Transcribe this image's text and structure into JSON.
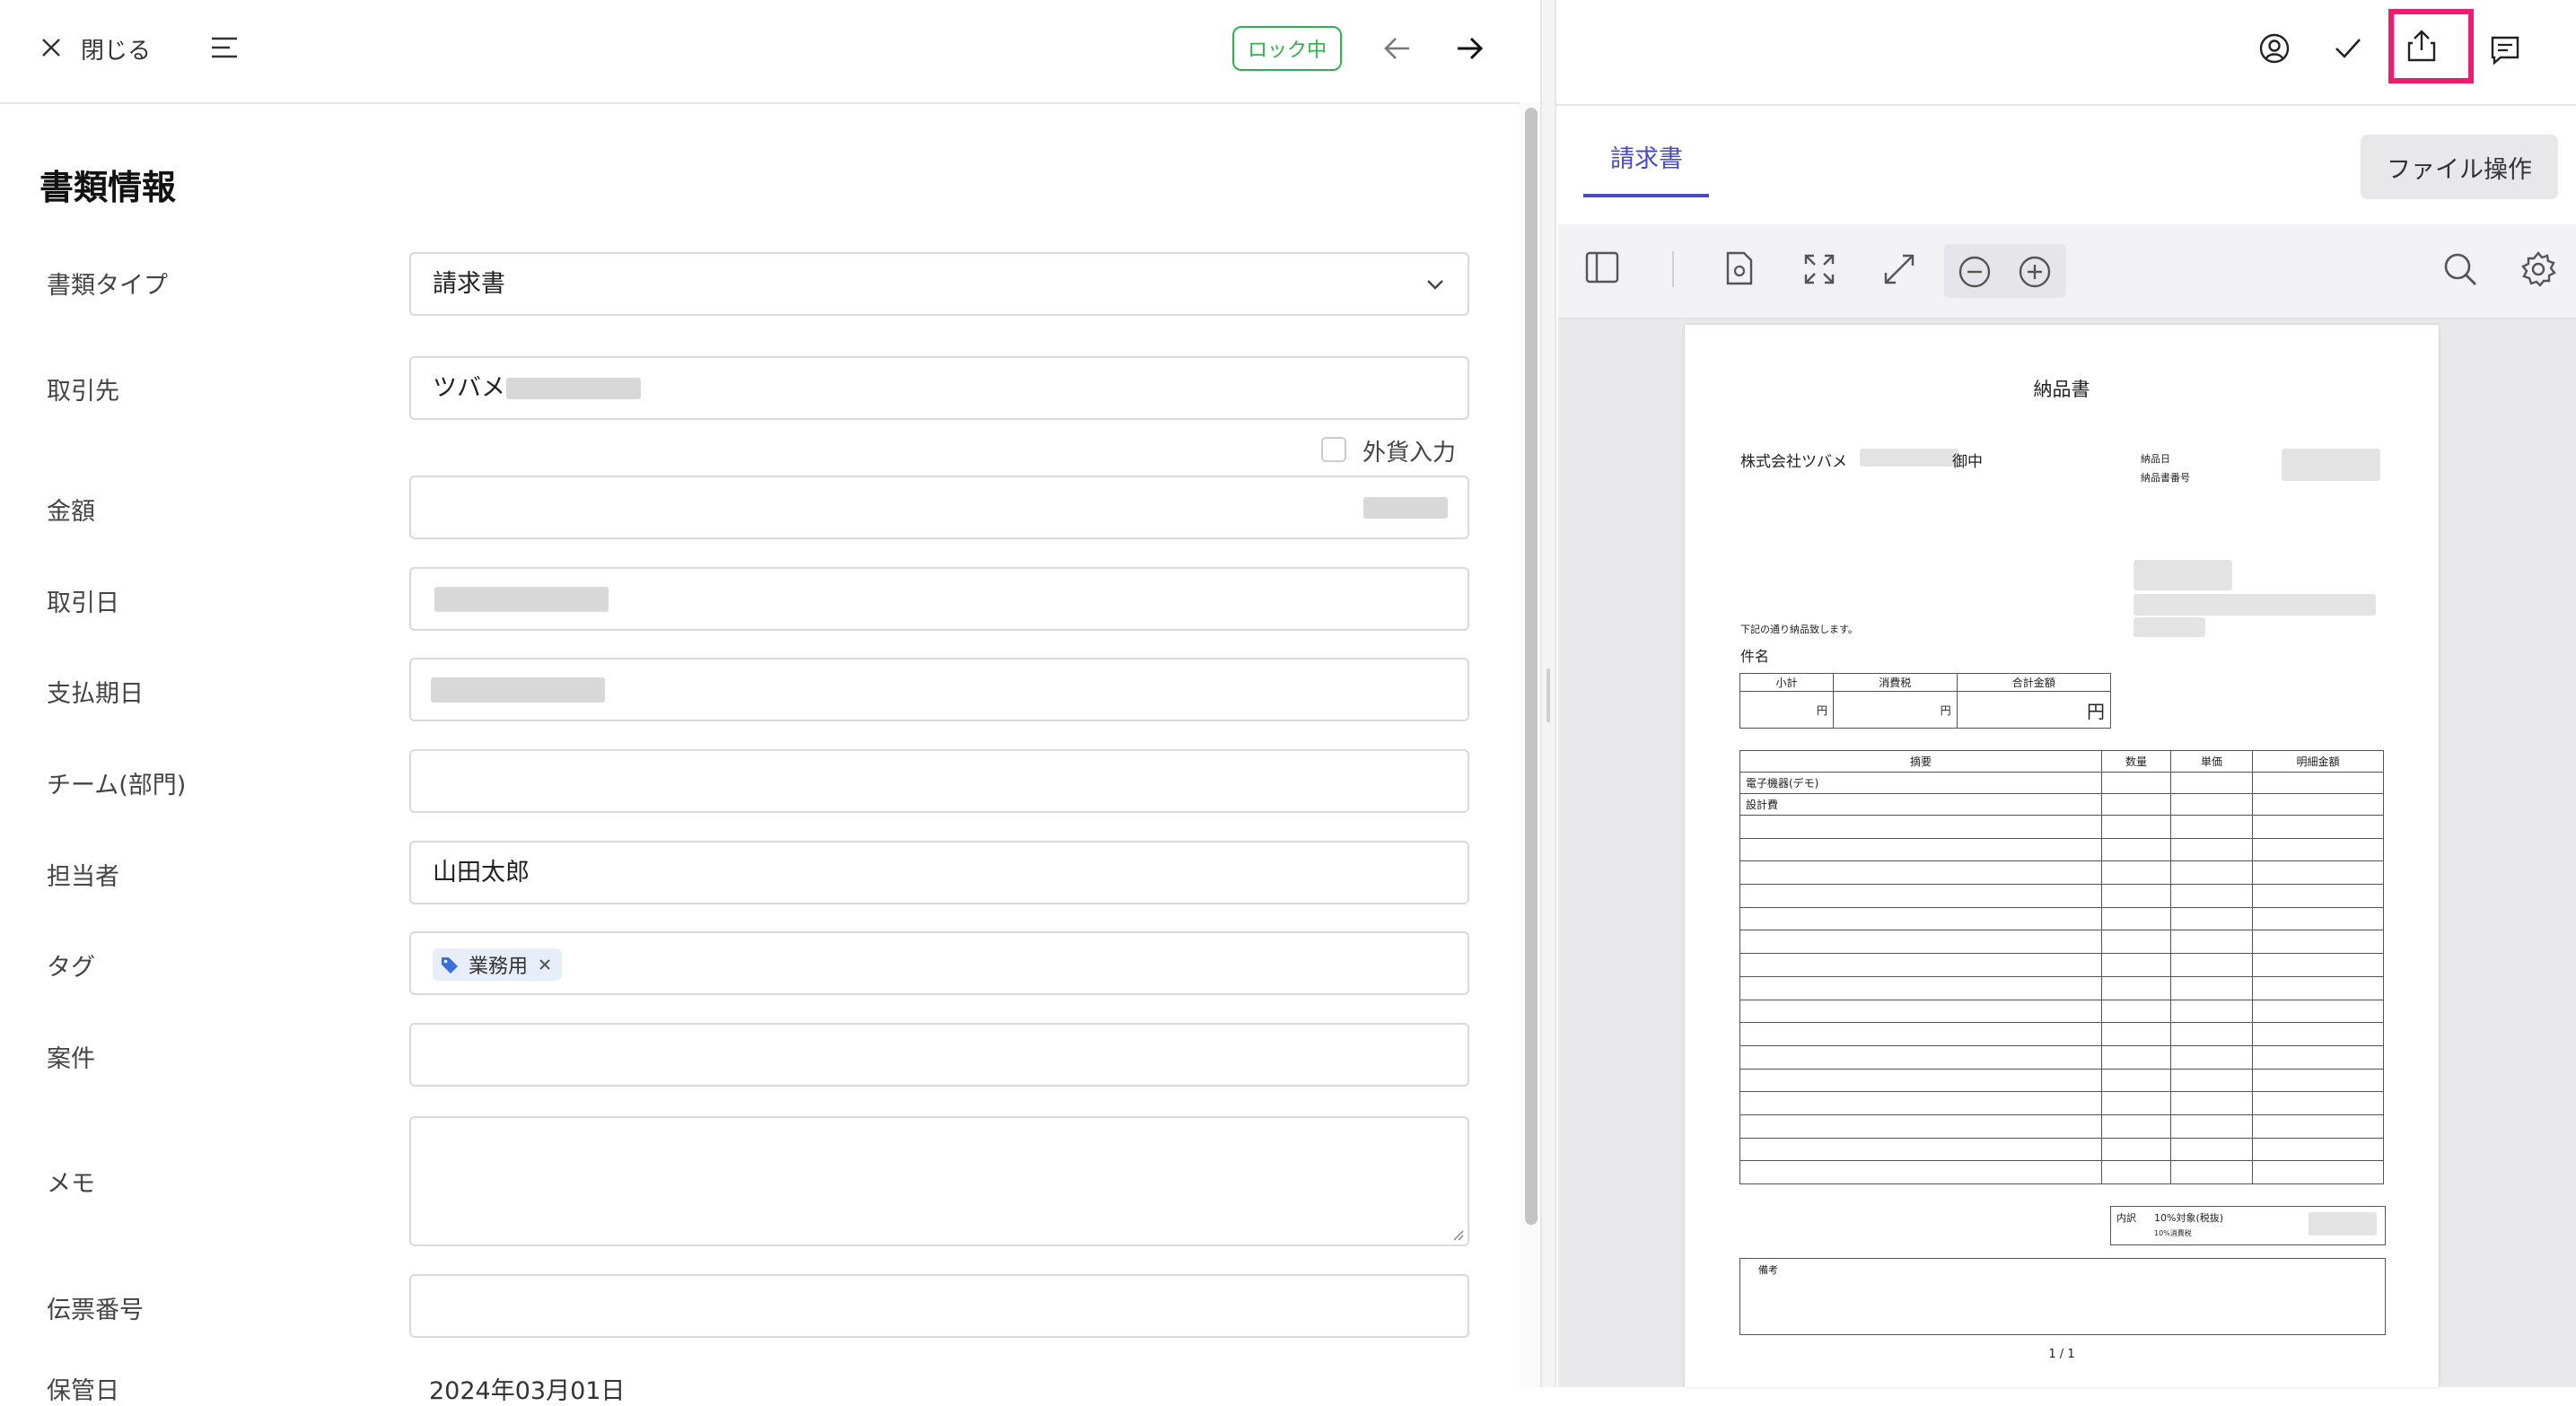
{
  "header": {
    "close_label": "閉じる",
    "lock_badge": "ロック中"
  },
  "form": {
    "title": "書類情報",
    "fields": {
      "doc_type": {
        "label": "書類タイプ",
        "value": "請求書"
      },
      "partner": {
        "label": "取引先",
        "value": "ツバメ"
      },
      "foreign_currency": {
        "label": "外貨入力"
      },
      "amount": {
        "label": "金額"
      },
      "trade_date": {
        "label": "取引日"
      },
      "due_date": {
        "label": "支払期日"
      },
      "team": {
        "label": "チーム(部門)"
      },
      "assignee": {
        "label": "担当者",
        "value": "山田太郎"
      },
      "tags": {
        "label": "タグ",
        "chip": "業務用"
      },
      "project": {
        "label": "案件"
      },
      "memo": {
        "label": "メモ"
      },
      "slip_no": {
        "label": "伝票番号"
      },
      "storage_date": {
        "label": "保管日",
        "value": "2024年03月01日"
      }
    }
  },
  "right": {
    "tab_label": "請求書",
    "file_ops_label": "ファイル操作"
  },
  "pdf": {
    "title": "納品書",
    "recipient_prefix": "株式会社ツバメ",
    "recipient_suffix": "御中",
    "delivery_date_label": "納品日",
    "delivery_no_label": "納品書番号",
    "note": "下記の通り納品致します。",
    "subject_label": "件名",
    "summary": {
      "subtotal": "小計",
      "tax": "消費税",
      "total": "合計金額",
      "yen": "円"
    },
    "items_headers": [
      "摘要",
      "数量",
      "単価",
      "明細金額"
    ],
    "items": [
      "電子機器(デモ)",
      "設計費"
    ],
    "breakdown_label": "内訳",
    "breakdown_value": "10%対象(税抜)",
    "breakdown_sub": "10%消費税",
    "remarks_label": "備考",
    "page": "1 / 1"
  },
  "colors": {
    "accent": "#4a4ac8",
    "lock_green": "#2fb24c",
    "highlight": "#ee1c6e",
    "tag_blue": "#3b6fd8"
  }
}
